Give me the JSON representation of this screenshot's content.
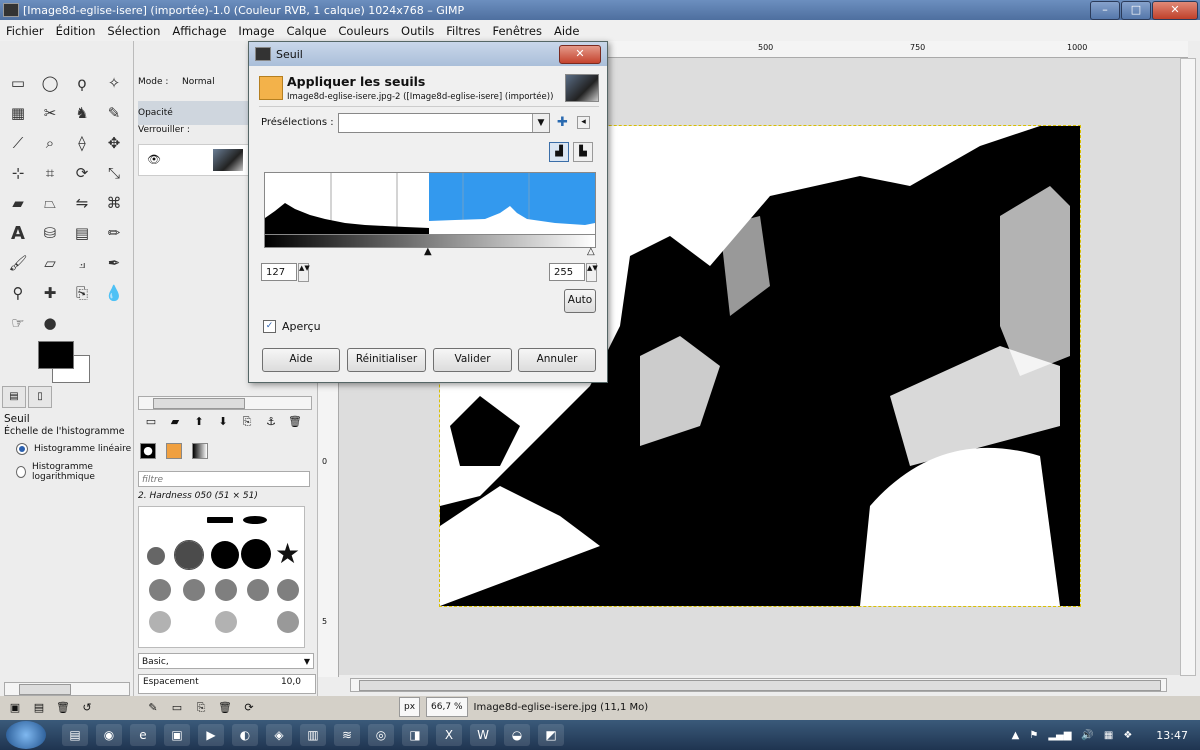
{
  "window": {
    "title": "[Image8d-eglise-isere] (importée)-1.0 (Couleur RVB, 1 calque) 1024x768 – GIMP"
  },
  "menu": [
    "Fichier",
    "Édition",
    "Sélection",
    "Affichage",
    "Image",
    "Calque",
    "Couleurs",
    "Outils",
    "Filtres",
    "Fenêtres",
    "Aide"
  ],
  "toolbox": {
    "icons": [
      "rect-select-icon",
      "ellipse-select-icon",
      "lasso-icon",
      "fuzzy-select-icon",
      "color-select-icon",
      "scissors-icon",
      "foreground-select-icon",
      "paths-icon",
      "color-picker-icon",
      "zoom-icon",
      "measure-icon",
      "move-icon",
      "align-icon",
      "crop-icon",
      "rotate-icon",
      "scale-icon",
      "shear-icon",
      "perspective-icon",
      "flip-icon",
      "cage-icon",
      "text-icon",
      "bucket-fill-icon",
      "blend-icon",
      "pencil-icon",
      "paintbrush-icon",
      "eraser-icon",
      "airbrush-icon",
      "ink-icon",
      "clone-icon",
      "heal-icon",
      "perspective-clone-icon",
      "blur-icon",
      "smudge-icon",
      "dodge-burn-icon"
    ],
    "tool_options_title": "Seuil",
    "tool_options_sub": "Échelle de l'histogramme",
    "radio_linear": "Histogramme linéaire",
    "radio_log": "Histogramme logarithmique"
  },
  "layers": {
    "mode_label": "Mode :",
    "mode_value": "Normal",
    "opacity_label": "Opacité",
    "lock_label": "Verrouiller :"
  },
  "brushes": {
    "filter_placeholder": "filtre",
    "selected_brush": "2. Hardness 050 (51 × 51)",
    "preset": "Basic,",
    "spacing_label": "Espacement",
    "spacing_value": "10,0"
  },
  "rulers": {
    "h": [
      "500",
      "750",
      "1000"
    ],
    "v": [
      "0",
      "5",
      "0"
    ]
  },
  "status": {
    "unit": "px",
    "zoom": "66,7 %",
    "file": "Image8d-eglise-isere.jpg (11,1 Mo)"
  },
  "dialog": {
    "title": "Seuil",
    "header": "Appliquer les seuils",
    "subheader": "Image8d-eglise-isere.jpg-2 ([Image8d-eglise-isere] (importée))",
    "presets_label": "Présélections :",
    "low": "127",
    "high": "255",
    "auto": "Auto",
    "preview_label": "Aperçu",
    "buttons": {
      "help": "Aide",
      "reset": "Réinitialiser",
      "ok": "Valider",
      "cancel": "Annuler"
    }
  },
  "taskbar": {
    "time": "13:47"
  }
}
